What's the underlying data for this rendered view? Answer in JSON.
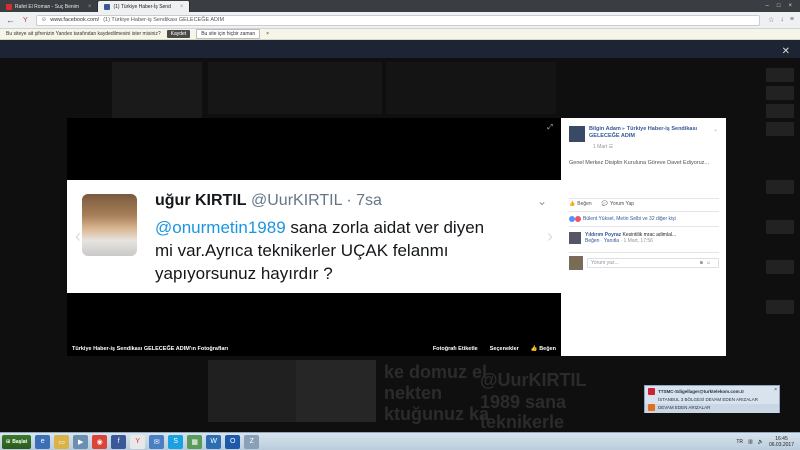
{
  "browser": {
    "tabs": [
      {
        "label": "Rafet El Roman - Suç Benim",
        "color": "#d32f2f"
      },
      {
        "label": "(1) Türkiye Haber-İş Send",
        "color": "#3b5998"
      }
    ],
    "url_host": "www.facebook.com/",
    "url_title": "(1) Türkiye Haber-iş Sendikası GELECEĞE ADIM"
  },
  "infobar": {
    "message": "Bu siteye ait şifrenizin Yandex tarafından kaydedilmesini ister misiniz?",
    "save_label": "Kaydet",
    "never_label": "Bu site için hiçbir zaman",
    "close": "×"
  },
  "viewer": {
    "tweet_name": "uğur KIRTIL",
    "tweet_handle": " @UurKIRTIL · 7sa",
    "tweet_mention": "@onurmetin1989",
    "tweet_line1_rest": " sana zorla aidat ver diyen",
    "tweet_line2": "mi var.Ayrıca teknikerler UÇAK felanmı",
    "tweet_line3": "yapıyorsunuz hayırdır ?",
    "album_caption": "Türkiye Haber-iş Sendikası GELECEĞE ADIM'ın Fotoğrafları",
    "tag_label": "Fotoğrafı Etiketle",
    "options_label": "Seçenekler",
    "like_label": "Beğen"
  },
  "panel": {
    "author": "Bilgin Adam",
    "arrow": " ▸ ",
    "page": "Türkiye Haber-iş Sendikası GELECEĞE ADIM",
    "date": "1 Mart",
    "text": "Genel Merkez Disiplin Kuruluna Göreve Davet Ediyoruz...",
    "like_action": "Beğen",
    "comment_action": "Yorum Yap",
    "likes_text": "Bülent Yüksel, Metin Selbi ve 32 diğer kişi",
    "comment_author": "Yıldırım Poyraz",
    "comment_text": " Kesintilik mrac adimlal...",
    "comment_like": "Beğen",
    "comment_reply": "Yanıtla",
    "comment_time": "1 Mart, 17:56",
    "input_placeholder": "Yorum yaz..."
  },
  "toast": {
    "line1": "TTSMC-Sdigellager@turktelekom.com.tr",
    "line2": "İSTANBUL 3 BÖLGESİ DEVAM EDEN ARIZALAR",
    "line3": "DEVAM EDEN ARIZALAR"
  },
  "taskbar": {
    "start_label": "Başlat",
    "lang": "TR",
    "time": "16:45",
    "date": "06.03.2017"
  }
}
